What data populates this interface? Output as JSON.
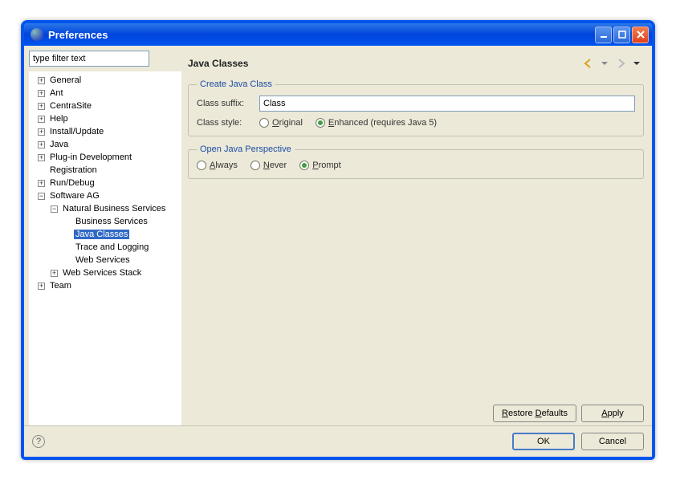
{
  "window": {
    "title": "Preferences"
  },
  "sidebar": {
    "filter_placeholder": "type filter text",
    "tree": [
      {
        "label": "General",
        "indent": 0,
        "expander": "plus"
      },
      {
        "label": "Ant",
        "indent": 0,
        "expander": "plus"
      },
      {
        "label": "CentraSite",
        "indent": 0,
        "expander": "plus"
      },
      {
        "label": "Help",
        "indent": 0,
        "expander": "plus"
      },
      {
        "label": "Install/Update",
        "indent": 0,
        "expander": "plus"
      },
      {
        "label": "Java",
        "indent": 0,
        "expander": "plus"
      },
      {
        "label": "Plug-in Development",
        "indent": 0,
        "expander": "plus"
      },
      {
        "label": "Registration",
        "indent": 0,
        "expander": "none"
      },
      {
        "label": "Run/Debug",
        "indent": 0,
        "expander": "plus"
      },
      {
        "label": "Software AG",
        "indent": 0,
        "expander": "minus"
      },
      {
        "label": "Natural Business Services",
        "indent": 1,
        "expander": "minus"
      },
      {
        "label": "Business Services",
        "indent": 2,
        "expander": "none"
      },
      {
        "label": "Java Classes",
        "indent": 2,
        "expander": "none",
        "selected": true
      },
      {
        "label": "Trace and Logging",
        "indent": 2,
        "expander": "none"
      },
      {
        "label": "Web Services",
        "indent": 2,
        "expander": "none"
      },
      {
        "label": "Web Services Stack",
        "indent": 1,
        "expander": "plus"
      },
      {
        "label": "Team",
        "indent": 0,
        "expander": "plus"
      }
    ]
  },
  "main": {
    "title": "Java Classes",
    "group1": {
      "legend": "Create Java Class",
      "suffix_label": "Class suffix:",
      "suffix_value": "Class",
      "style_label": "Class style:",
      "radio_original": "Original",
      "radio_enhanced": "Enhanced (requires Java 5)",
      "style_selected": "enhanced"
    },
    "group2": {
      "legend": "Open Java Perspective",
      "radio_always": "Always",
      "radio_never": "Never",
      "radio_prompt": "Prompt",
      "selected": "prompt"
    },
    "footer": {
      "restore": "Restore Defaults",
      "apply": "Apply"
    }
  },
  "bottom": {
    "ok": "OK",
    "cancel": "Cancel"
  }
}
